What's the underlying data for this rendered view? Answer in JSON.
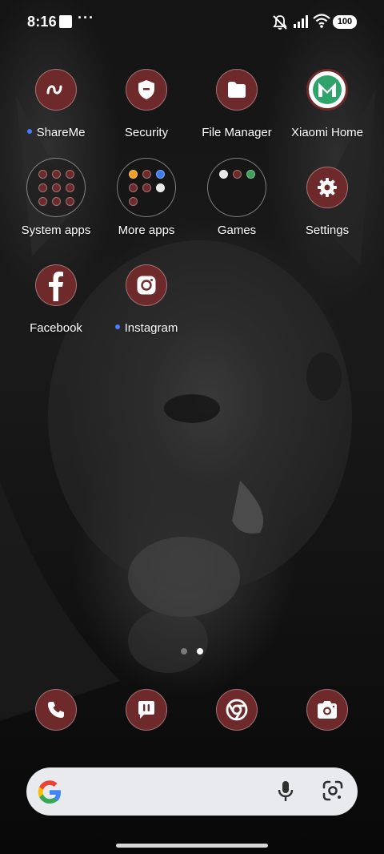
{
  "status_bar": {
    "time": "8:16",
    "overflow_indicator": "···",
    "battery_level": "100",
    "icons": [
      "notification-square-icon",
      "silent-icon",
      "signal-icon",
      "wifi-icon",
      "battery-icon"
    ]
  },
  "apps": {
    "shareme": {
      "label": "ShareMe",
      "icon": "shareme-icon",
      "new_dot": true
    },
    "security": {
      "label": "Security",
      "icon": "shield-icon"
    },
    "file_manager": {
      "label": "File Manager",
      "icon": "folder-icon"
    },
    "xiaomi_home": {
      "label": "Xiaomi Home",
      "icon": "xiaomi-home-icon"
    },
    "system_apps": {
      "label": "System apps",
      "icon": "folder-preview-icon"
    },
    "more_apps": {
      "label": "More apps",
      "icon": "folder-preview-icon"
    },
    "games": {
      "label": "Games",
      "icon": "folder-preview-icon"
    },
    "settings": {
      "label": "Settings",
      "icon": "gear-icon"
    },
    "facebook": {
      "label": "Facebook",
      "icon": "facebook-icon"
    },
    "instagram": {
      "label": "Instagram",
      "icon": "instagram-icon",
      "new_dot": true
    }
  },
  "page_indicator": {
    "pages": 2,
    "current": 2
  },
  "dock": [
    {
      "name": "phone",
      "icon": "phone-icon"
    },
    {
      "name": "messages",
      "icon": "message-icon"
    },
    {
      "name": "chrome",
      "icon": "chrome-icon"
    },
    {
      "name": "camera",
      "icon": "camera-icon"
    }
  ],
  "search": {
    "logo": "google-logo",
    "icons": [
      "microphone-icon",
      "google-lens-icon"
    ]
  },
  "colors": {
    "icon_bg": "#6e2a2a",
    "new_dot": "#4a7cff",
    "search_bg": "#e9eaee",
    "text": "#ffffff"
  }
}
